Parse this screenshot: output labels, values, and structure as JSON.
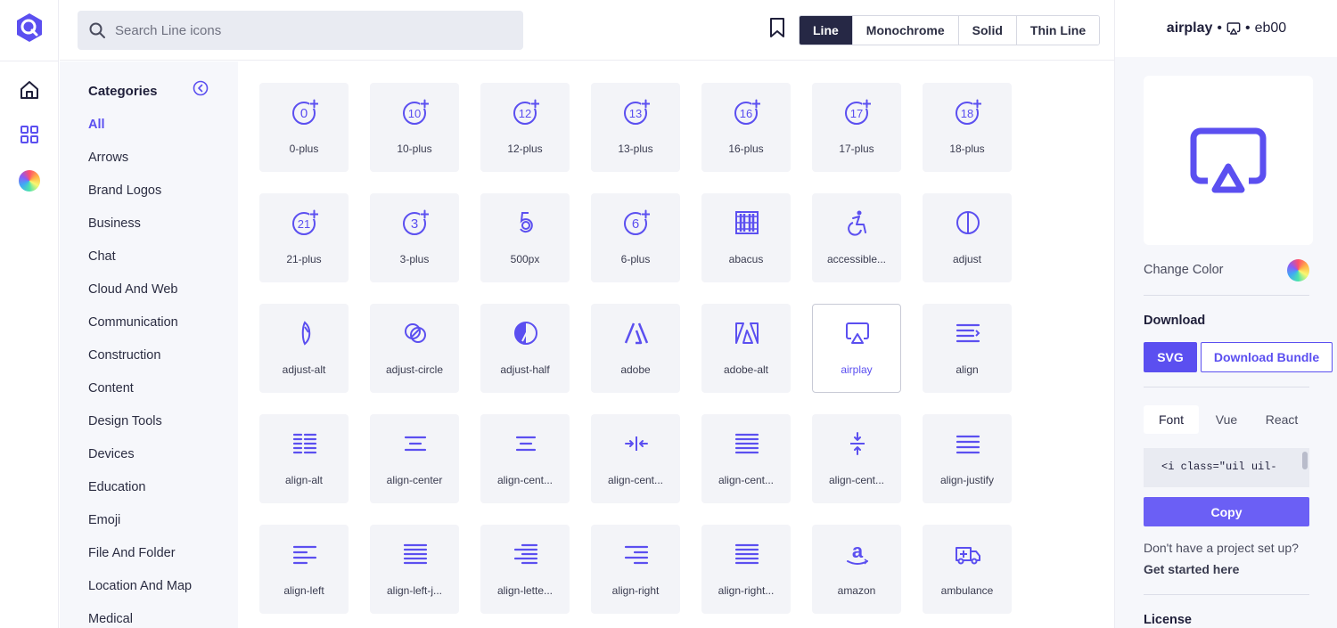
{
  "colors": {
    "accent": "#5b4ff0",
    "dark": "#262845",
    "tile_bg": "#f3f4f8"
  },
  "search": {
    "placeholder": "Search Line icons"
  },
  "style_tabs": [
    {
      "label": "Line",
      "active": true
    },
    {
      "label": "Monochrome",
      "active": false
    },
    {
      "label": "Solid",
      "active": false
    },
    {
      "label": "Thin Line",
      "active": false
    }
  ],
  "sidebar": {
    "title": "Categories",
    "items": [
      {
        "label": "All",
        "active": true
      },
      {
        "label": "Arrows"
      },
      {
        "label": "Brand Logos"
      },
      {
        "label": "Business"
      },
      {
        "label": "Chat"
      },
      {
        "label": "Cloud And Web"
      },
      {
        "label": "Communication"
      },
      {
        "label": "Construction"
      },
      {
        "label": "Content"
      },
      {
        "label": "Design Tools"
      },
      {
        "label": "Devices"
      },
      {
        "label": "Education"
      },
      {
        "label": "Emoji"
      },
      {
        "label": "File And Folder"
      },
      {
        "label": "Location And Map"
      },
      {
        "label": "Medical"
      }
    ]
  },
  "icons": [
    {
      "label": "0-plus",
      "icon": "0-plus-icon",
      "glyph": "0"
    },
    {
      "label": "10-plus",
      "icon": "10-plus-icon",
      "glyph": "10"
    },
    {
      "label": "12-plus",
      "icon": "12-plus-icon",
      "glyph": "12"
    },
    {
      "label": "13-plus",
      "icon": "13-plus-icon",
      "glyph": "13"
    },
    {
      "label": "16-plus",
      "icon": "16-plus-icon",
      "glyph": "16"
    },
    {
      "label": "17-plus",
      "icon": "17-plus-icon",
      "glyph": "17"
    },
    {
      "label": "18-plus",
      "icon": "18-plus-icon",
      "glyph": "18"
    },
    {
      "label": "21-plus",
      "icon": "21-plus-icon",
      "glyph": "21"
    },
    {
      "label": "3-plus",
      "icon": "3-plus-icon",
      "glyph": "3"
    },
    {
      "label": "500px",
      "icon": "500px-icon"
    },
    {
      "label": "6-plus",
      "icon": "6-plus-icon",
      "glyph": "6"
    },
    {
      "label": "abacus",
      "icon": "abacus-icon"
    },
    {
      "label": "accessible...",
      "icon": "accessible-icon"
    },
    {
      "label": "adjust",
      "icon": "adjust-icon"
    },
    {
      "label": "adjust-alt",
      "icon": "adjust-alt-icon"
    },
    {
      "label": "adjust-circle",
      "icon": "adjust-circle-icon"
    },
    {
      "label": "adjust-half",
      "icon": "adjust-half-icon"
    },
    {
      "label": "adobe",
      "icon": "adobe-icon"
    },
    {
      "label": "adobe-alt",
      "icon": "adobe-alt-icon"
    },
    {
      "label": "airplay",
      "icon": "airplay-icon",
      "selected": true
    },
    {
      "label": "align",
      "icon": "align-icon"
    },
    {
      "label": "align-alt",
      "icon": "align-alt-icon"
    },
    {
      "label": "align-center",
      "icon": "align-center-icon"
    },
    {
      "label": "align-cent...",
      "icon": "align-center-alt-icon"
    },
    {
      "label": "align-cent...",
      "icon": "align-center-h-icon"
    },
    {
      "label": "align-cent...",
      "icon": "align-center-justify-icon"
    },
    {
      "label": "align-cent...",
      "icon": "align-center-v-icon"
    },
    {
      "label": "align-justify",
      "icon": "align-justify-icon"
    },
    {
      "label": "align-left",
      "icon": "align-left-icon"
    },
    {
      "label": "align-left-j...",
      "icon": "align-left-justify-icon"
    },
    {
      "label": "align-lette...",
      "icon": "align-letter-rtl-icon"
    },
    {
      "label": "align-right",
      "icon": "align-right-icon"
    },
    {
      "label": "align-right...",
      "icon": "align-right-justify-icon"
    },
    {
      "label": "amazon",
      "icon": "amazon-icon"
    },
    {
      "label": "ambulance",
      "icon": "ambulance-icon"
    }
  ],
  "panel": {
    "icon_name": "airplay",
    "separator": "•",
    "icon_code": "eb00",
    "change_color": "Change Color",
    "download_title": "Download",
    "svg_button": "SVG",
    "bundle_button": "Download Bundle",
    "code_tabs": [
      {
        "label": "Font",
        "active": true
      },
      {
        "label": "Vue"
      },
      {
        "label": "React"
      }
    ],
    "code_snippet": "<i class=\"uil uil-",
    "copy_button": "Copy",
    "no_project": "Don't have a project set up?",
    "get_started": "Get started here",
    "license_title": "License"
  }
}
